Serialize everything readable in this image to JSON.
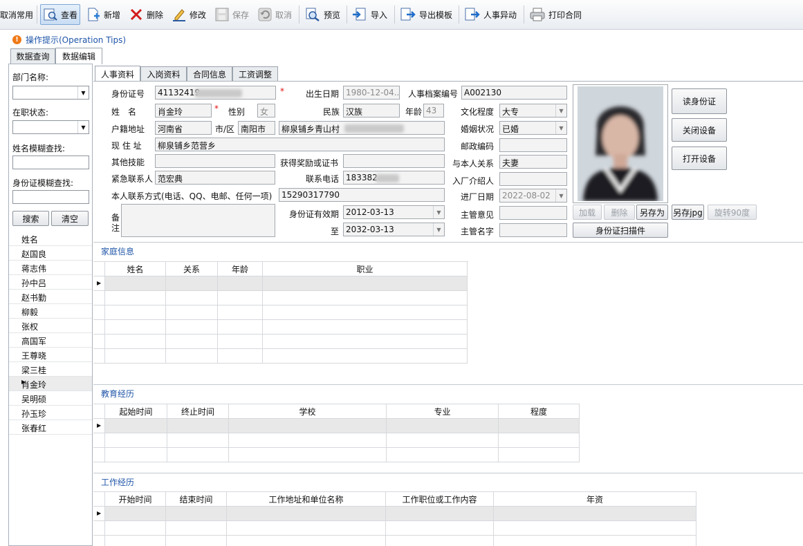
{
  "toolbar": {
    "items": [
      {
        "label": "取消常用",
        "icon": "unpin-icon",
        "disabled": false
      },
      {
        "label": "查看",
        "icon": "view-icon",
        "disabled": false,
        "active": true
      },
      {
        "label": "新增",
        "icon": "new-file-icon",
        "disabled": false
      },
      {
        "label": "删除",
        "icon": "delete-x-icon",
        "disabled": false
      },
      {
        "label": "修改",
        "icon": "pencil-icon",
        "disabled": false
      },
      {
        "label": "保存",
        "icon": "save-disk-icon",
        "disabled": true
      },
      {
        "label": "取消",
        "icon": "undo-icon",
        "disabled": true
      },
      {
        "label": "预览",
        "icon": "preview-magnifier-icon",
        "disabled": false
      },
      {
        "label": "导入",
        "icon": "import-icon",
        "disabled": false
      },
      {
        "label": "导出模板",
        "icon": "export-template-icon",
        "disabled": false
      },
      {
        "label": "人事异动",
        "icon": "personnel-change-icon",
        "disabled": false
      },
      {
        "label": "打印合同",
        "icon": "printer-icon",
        "disabled": false
      }
    ]
  },
  "tips": {
    "label": "操作提示(Operation Tips)"
  },
  "outer_tabs": [
    {
      "label": "数据查询"
    },
    {
      "label": "数据编辑",
      "selected": true
    }
  ],
  "left": {
    "dept_label": "部门名称:",
    "status_label": "在职状态:",
    "name_search_label": "姓名模糊查找:",
    "id_search_label": "身份证模糊查找:",
    "search_button": "搜索",
    "clear_button": "清空",
    "list_header": "姓名",
    "names": [
      "赵国良",
      "蒋志伟",
      "孙中吕",
      "赵书勤",
      "柳毅",
      "张权",
      "高国军",
      "王尊晓",
      "梁三桂",
      "肖金玲",
      "吴明硕",
      "孙玉珍",
      "张春红"
    ],
    "selected_name": "肖金玲"
  },
  "inner_tabs": [
    {
      "label": "人事资料",
      "selected": true
    },
    {
      "label": "入岗资料"
    },
    {
      "label": "合同信息"
    },
    {
      "label": "工资调整"
    }
  ],
  "form": {
    "id_no_label": "身份证号",
    "id_no_value": "41132419",
    "birth_label": "出生日期",
    "birth_value": "1980-12-04...",
    "archive_label": "人事档案编号",
    "archive_value": "A002130",
    "name_label": "姓　名",
    "name_value": "肖金玲",
    "gender_label": "性别",
    "gender_value": "女",
    "ethnic_label": "民族",
    "ethnic_value": "汉族",
    "age_label": "年龄",
    "age_value": "43",
    "edu_label": "文化程度",
    "edu_value": "大专",
    "hukou_label": "户籍地址",
    "hukou_value": "河南省",
    "city_label": "市/区",
    "city_value": "南阳市",
    "hukou_detail_value": "柳泉铺乡青山村",
    "marital_label": "婚姻状况",
    "marital_value": "已婚",
    "address_label": "现 住 址",
    "address_value": "柳泉铺乡范营乡",
    "postcode_label": "邮政编码",
    "skill_label": "其他技能",
    "award_label": "获得奖励或证书",
    "relation_label": "与本人关系",
    "relation_value": "夫妻",
    "emergency_label": "紧急联系人",
    "emergency_value": "范宏典",
    "phone_label": "联系电话",
    "phone_value": "183382",
    "referrer_label": "入厂介绍人",
    "contact_label": "本人联系方式(电话、QQ、电邮、任何一项)",
    "contact_value": "15290317790",
    "entry_label": "进厂日期",
    "entry_value": "2022-08-02",
    "remark_label_1": "备",
    "remark_label_2": "注",
    "id_valid_label": "身份证有效期",
    "id_valid_from": "2012-03-13",
    "to_label": "至",
    "id_valid_to": "2032-03-13",
    "supervisor_opinion_label": "主管意见",
    "supervisor_sign_label": "主管名字"
  },
  "photo_buttons": {
    "read_id": "读身份证",
    "close_device": "关闭设备",
    "open_device": "打开设备",
    "load": "加载",
    "delete": "删除",
    "save_as": "另存为",
    "save_jpg": "另存jpg",
    "rotate": "旋转90度",
    "scan": "身份证扫描件"
  },
  "family": {
    "title": "家庭信息",
    "columns": [
      "姓名",
      "关系",
      "年龄",
      "职业"
    ]
  },
  "education": {
    "title": "教育经历",
    "columns": [
      "起始时间",
      "终止时间",
      "学校",
      "专业",
      "程度"
    ]
  },
  "work": {
    "title": "工作经历",
    "columns": [
      "开始时间",
      "结束时间",
      "工作地址和单位名称",
      "工作职位或工作内容",
      "年资"
    ]
  }
}
